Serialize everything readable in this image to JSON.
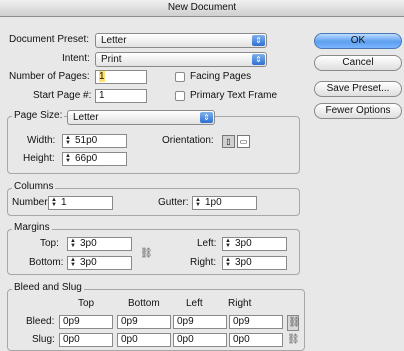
{
  "window": {
    "title": "New Document"
  },
  "doc": {
    "preset_label": "Document Preset:",
    "preset_value": "Letter",
    "intent_label": "Intent:",
    "intent_value": "Print",
    "pages_label": "Number of Pages:",
    "pages_value": "1",
    "start_label": "Start Page #:",
    "start_value": "1",
    "facing_label": "Facing Pages",
    "primary_label": "Primary Text Frame"
  },
  "page_size": {
    "legend": "Page Size:",
    "value": "Letter",
    "width_label": "Width:",
    "width_value": "51p0",
    "height_label": "Height:",
    "height_value": "66p0",
    "orientation_label": "Orientation:"
  },
  "columns": {
    "legend": "Columns",
    "number_label": "Number:",
    "number_value": "1",
    "gutter_label": "Gutter:",
    "gutter_value": "1p0"
  },
  "margins": {
    "legend": "Margins",
    "top_label": "Top:",
    "top_value": "3p0",
    "bottom_label": "Bottom:",
    "bottom_value": "3p0",
    "left_label": "Left:",
    "left_value": "3p0",
    "right_label": "Right:",
    "right_value": "3p0"
  },
  "bleed": {
    "legend": "Bleed and Slug",
    "headers": [
      "Top",
      "Bottom",
      "Left",
      "Right"
    ],
    "bleed_label": "Bleed:",
    "bleed_values": [
      "0p9",
      "0p9",
      "0p9",
      "0p9"
    ],
    "slug_label": "Slug:",
    "slug_values": [
      "0p0",
      "0p0",
      "0p0",
      "0p0"
    ]
  },
  "buttons": {
    "ok": "OK",
    "cancel": "Cancel",
    "save_preset": "Save Preset...",
    "fewer": "Fewer Options"
  },
  "icons": {
    "stepper": "stepper-icon",
    "chain": "chain-link-icon",
    "portrait": "portrait-icon",
    "landscape": "landscape-icon"
  }
}
